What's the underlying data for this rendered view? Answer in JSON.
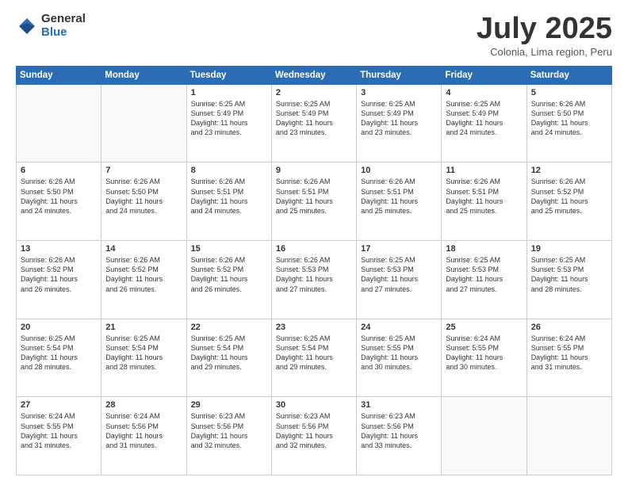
{
  "logo": {
    "general": "General",
    "blue": "Blue"
  },
  "header": {
    "month_year": "July 2025",
    "location": "Colonia, Lima region, Peru"
  },
  "weekdays": [
    "Sunday",
    "Monday",
    "Tuesday",
    "Wednesday",
    "Thursday",
    "Friday",
    "Saturday"
  ],
  "weeks": [
    [
      {
        "day": "",
        "info": ""
      },
      {
        "day": "",
        "info": ""
      },
      {
        "day": "1",
        "info": "Sunrise: 6:25 AM\nSunset: 5:49 PM\nDaylight: 11 hours\nand 23 minutes."
      },
      {
        "day": "2",
        "info": "Sunrise: 6:25 AM\nSunset: 5:49 PM\nDaylight: 11 hours\nand 23 minutes."
      },
      {
        "day": "3",
        "info": "Sunrise: 6:25 AM\nSunset: 5:49 PM\nDaylight: 11 hours\nand 23 minutes."
      },
      {
        "day": "4",
        "info": "Sunrise: 6:25 AM\nSunset: 5:49 PM\nDaylight: 11 hours\nand 24 minutes."
      },
      {
        "day": "5",
        "info": "Sunrise: 6:26 AM\nSunset: 5:50 PM\nDaylight: 11 hours\nand 24 minutes."
      }
    ],
    [
      {
        "day": "6",
        "info": "Sunrise: 6:26 AM\nSunset: 5:50 PM\nDaylight: 11 hours\nand 24 minutes."
      },
      {
        "day": "7",
        "info": "Sunrise: 6:26 AM\nSunset: 5:50 PM\nDaylight: 11 hours\nand 24 minutes."
      },
      {
        "day": "8",
        "info": "Sunrise: 6:26 AM\nSunset: 5:51 PM\nDaylight: 11 hours\nand 24 minutes."
      },
      {
        "day": "9",
        "info": "Sunrise: 6:26 AM\nSunset: 5:51 PM\nDaylight: 11 hours\nand 25 minutes."
      },
      {
        "day": "10",
        "info": "Sunrise: 6:26 AM\nSunset: 5:51 PM\nDaylight: 11 hours\nand 25 minutes."
      },
      {
        "day": "11",
        "info": "Sunrise: 6:26 AM\nSunset: 5:51 PM\nDaylight: 11 hours\nand 25 minutes."
      },
      {
        "day": "12",
        "info": "Sunrise: 6:26 AM\nSunset: 5:52 PM\nDaylight: 11 hours\nand 25 minutes."
      }
    ],
    [
      {
        "day": "13",
        "info": "Sunrise: 6:26 AM\nSunset: 5:52 PM\nDaylight: 11 hours\nand 26 minutes."
      },
      {
        "day": "14",
        "info": "Sunrise: 6:26 AM\nSunset: 5:52 PM\nDaylight: 11 hours\nand 26 minutes."
      },
      {
        "day": "15",
        "info": "Sunrise: 6:26 AM\nSunset: 5:52 PM\nDaylight: 11 hours\nand 26 minutes."
      },
      {
        "day": "16",
        "info": "Sunrise: 6:26 AM\nSunset: 5:53 PM\nDaylight: 11 hours\nand 27 minutes."
      },
      {
        "day": "17",
        "info": "Sunrise: 6:25 AM\nSunset: 5:53 PM\nDaylight: 11 hours\nand 27 minutes."
      },
      {
        "day": "18",
        "info": "Sunrise: 6:25 AM\nSunset: 5:53 PM\nDaylight: 11 hours\nand 27 minutes."
      },
      {
        "day": "19",
        "info": "Sunrise: 6:25 AM\nSunset: 5:53 PM\nDaylight: 11 hours\nand 28 minutes."
      }
    ],
    [
      {
        "day": "20",
        "info": "Sunrise: 6:25 AM\nSunset: 5:54 PM\nDaylight: 11 hours\nand 28 minutes."
      },
      {
        "day": "21",
        "info": "Sunrise: 6:25 AM\nSunset: 5:54 PM\nDaylight: 11 hours\nand 28 minutes."
      },
      {
        "day": "22",
        "info": "Sunrise: 6:25 AM\nSunset: 5:54 PM\nDaylight: 11 hours\nand 29 minutes."
      },
      {
        "day": "23",
        "info": "Sunrise: 6:25 AM\nSunset: 5:54 PM\nDaylight: 11 hours\nand 29 minutes."
      },
      {
        "day": "24",
        "info": "Sunrise: 6:25 AM\nSunset: 5:55 PM\nDaylight: 11 hours\nand 30 minutes."
      },
      {
        "day": "25",
        "info": "Sunrise: 6:24 AM\nSunset: 5:55 PM\nDaylight: 11 hours\nand 30 minutes."
      },
      {
        "day": "26",
        "info": "Sunrise: 6:24 AM\nSunset: 5:55 PM\nDaylight: 11 hours\nand 31 minutes."
      }
    ],
    [
      {
        "day": "27",
        "info": "Sunrise: 6:24 AM\nSunset: 5:55 PM\nDaylight: 11 hours\nand 31 minutes."
      },
      {
        "day": "28",
        "info": "Sunrise: 6:24 AM\nSunset: 5:56 PM\nDaylight: 11 hours\nand 31 minutes."
      },
      {
        "day": "29",
        "info": "Sunrise: 6:23 AM\nSunset: 5:56 PM\nDaylight: 11 hours\nand 32 minutes."
      },
      {
        "day": "30",
        "info": "Sunrise: 6:23 AM\nSunset: 5:56 PM\nDaylight: 11 hours\nand 32 minutes."
      },
      {
        "day": "31",
        "info": "Sunrise: 6:23 AM\nSunset: 5:56 PM\nDaylight: 11 hours\nand 33 minutes."
      },
      {
        "day": "",
        "info": ""
      },
      {
        "day": "",
        "info": ""
      }
    ]
  ]
}
